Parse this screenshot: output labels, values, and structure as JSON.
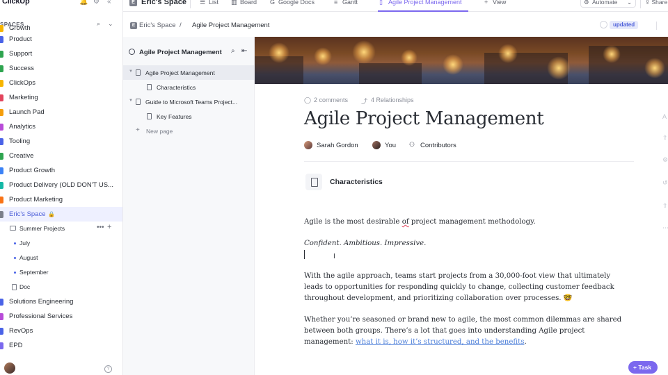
{
  "app": {
    "logo": "ClickUp",
    "spaces_header": "SPACES"
  },
  "sidebar": {
    "items": [
      {
        "label": "Growth",
        "color": "#f7b500"
      },
      {
        "label": "Product",
        "color": "#4a63e7"
      },
      {
        "label": "Support",
        "color": "#2ea44f"
      },
      {
        "label": "Success",
        "color": "#2ea44f"
      },
      {
        "label": "ClickOps",
        "color": "#f7b500"
      },
      {
        "label": "Marketing",
        "color": "#e2445c"
      },
      {
        "label": "Launch Pad",
        "color": "#f59e0b"
      },
      {
        "label": "Analytics",
        "color": "#b84bd8"
      },
      {
        "label": "Tooling",
        "color": "#4a63e7"
      },
      {
        "label": "Creative",
        "color": "#2ea44f"
      },
      {
        "label": "Product Growth",
        "color": "#3b82f6"
      },
      {
        "label": "Product Delivery (OLD DON'T US...",
        "color": "#14b8a6"
      },
      {
        "label": "Product Marketing",
        "color": "#f97316"
      },
      {
        "label": "Eric's Space",
        "color": "#7a7e89"
      }
    ],
    "folder": {
      "label": "Summer Projects"
    },
    "lists": [
      {
        "label": "July"
      },
      {
        "label": "August"
      },
      {
        "label": "September"
      }
    ],
    "doc": {
      "label": "Doc"
    },
    "items_after": [
      {
        "label": "Solutions Engineering",
        "color": "#4a63e7"
      },
      {
        "label": "Professional Services",
        "color": "#b84bd8"
      },
      {
        "label": "RevOps",
        "color": "#4a63e7"
      },
      {
        "label": "EPD",
        "color": "#7b68ee"
      }
    ]
  },
  "topbar": {
    "space_badge": "E",
    "space_title": "Eric's Space",
    "tabs": [
      {
        "label": "List"
      },
      {
        "label": "Board"
      },
      {
        "label": "Google Docs"
      },
      {
        "label": "Gantt"
      },
      {
        "label": "Agile Project Management"
      }
    ],
    "add_view": "View",
    "automate": "Automate",
    "share": "Share"
  },
  "breadcrumb": {
    "badge": "E",
    "space": "Eric's Space",
    "separator": "/",
    "page": "Agile Project Management",
    "status": "updated"
  },
  "outline": {
    "title": "Agile Project Management",
    "pages": [
      {
        "label": "Agile Project Management"
      },
      {
        "label": "Characteristics"
      },
      {
        "label": "Guide to Microsoft Teams Project..."
      },
      {
        "label": "Key Features"
      }
    ],
    "new_page": "New page"
  },
  "doc": {
    "comments": "2 comments",
    "relationships": "4 Relationships",
    "title": "Agile Project Management",
    "authors": [
      {
        "name": "Sarah Gordon"
      },
      {
        "name": "You"
      }
    ],
    "contributors": "Contributors",
    "subpage_title": "Characteristics",
    "p1_before": "Agile is the most desirable ",
    "p1_spell": "of",
    "p1_after": " project management methodology.",
    "p2": "Confident. Ambitious. Impressive.",
    "p3": "With the agile approach, teams start projects from a 30,000-foot view that ultimately leads to opportunities for responding quickly to change, collecting customer feedback throughout development, and prioritizing collaboration over processes. 🤓",
    "p4_text": "Whether you’re seasoned or brand new to agile, the most common dilemmas are shared between both groups. There’s a lot that goes into understanding Agile project management: ",
    "p4_link": "what it is, how it’s structured, and the benefits",
    "p4_end": "."
  },
  "task_button": "Task",
  "colors": {
    "accent": "#7b68ee",
    "link": "#4d7fd9"
  }
}
